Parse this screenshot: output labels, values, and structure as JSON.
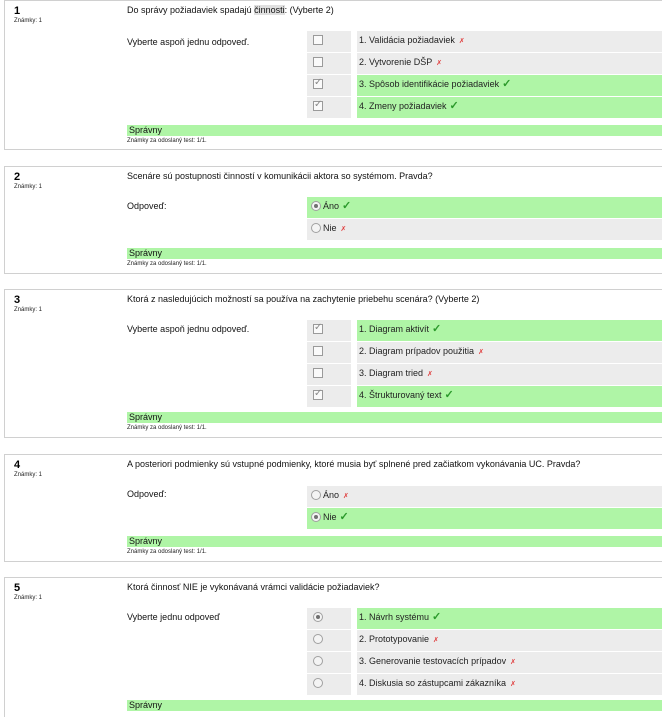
{
  "questions": [
    {
      "no": "1",
      "grade": "Známky: 1",
      "text_before": "Do správy požiadaviek spadajú ",
      "text_hl": "činnosti",
      "text_after": ": (Vyberte 2)",
      "prompt": "Vyberte aspoň jednu odpoveď.",
      "answers": [
        {
          "label": "1. Validácia požiadaviek",
          "mark": "✗"
        },
        {
          "label": "2. Vytvorenie DŠP",
          "mark": "✗"
        },
        {
          "label": "3. Spôsob identifikácie požiadaviek",
          "mark": "✓"
        },
        {
          "label": "4. Zmeny požiadaviek",
          "mark": "✓"
        }
      ],
      "feedback": "Správny",
      "gradeline": "Známky za odoslaný test: 1/1."
    },
    {
      "no": "2",
      "grade": "Známky: 1",
      "text": "Scenáre sú postupnosti činností v komunikácii aktora so systémom. Pravda?",
      "prompt": "Odpoveď:",
      "answers": [
        {
          "label": "Áno",
          "mark": "✓"
        },
        {
          "label": "Nie",
          "mark": "✗"
        }
      ],
      "feedback": "Správny",
      "gradeline": "Známky za odoslaný test: 1/1."
    },
    {
      "no": "3",
      "grade": "Známky: 1",
      "text": "Ktorá z nasledujúcich možností sa používa na zachytenie priebehu scenára? (Vyberte 2)",
      "prompt": "Vyberte aspoň jednu odpoveď.",
      "answers": [
        {
          "label": "1. Diagram aktivít",
          "mark": "✓"
        },
        {
          "label": "2. Diagram prípadov použitia",
          "mark": "✗"
        },
        {
          "label": "3. Diagram tried",
          "mark": "✗"
        },
        {
          "label": "4. Štrukturovaný text",
          "mark": "✓"
        }
      ],
      "feedback": "Správny",
      "gradeline": "Známky za odoslaný test: 1/1."
    },
    {
      "no": "4",
      "grade": "Známky: 1",
      "text": "A posteriori podmienky sú vstupné podmienky, ktoré musia byť splnené pred začiatkom vykonávania UC. Pravda?",
      "prompt": "Odpoveď:",
      "answers": [
        {
          "label": "Áno",
          "mark": "✗"
        },
        {
          "label": "Nie",
          "mark": "✓"
        }
      ],
      "feedback": "Správny",
      "gradeline": "Známky za odoslaný test: 1/1."
    },
    {
      "no": "5",
      "grade": "Známky: 1",
      "text": "Ktorá činnosť NIE je vykonávaná vrámci validácie požiadaviek?",
      "prompt": "Vyberte jednu odpoveď",
      "answers": [
        {
          "label": "1. Návrh systému",
          "mark": "✓"
        },
        {
          "label": "2. Prototypovanie",
          "mark": "✗"
        },
        {
          "label": "3. Generovanie testovacích prípadov",
          "mark": "✗"
        },
        {
          "label": "4. Diskusia so zástupcami zákazníka",
          "mark": "✗"
        }
      ],
      "feedback": "Správny"
    }
  ]
}
